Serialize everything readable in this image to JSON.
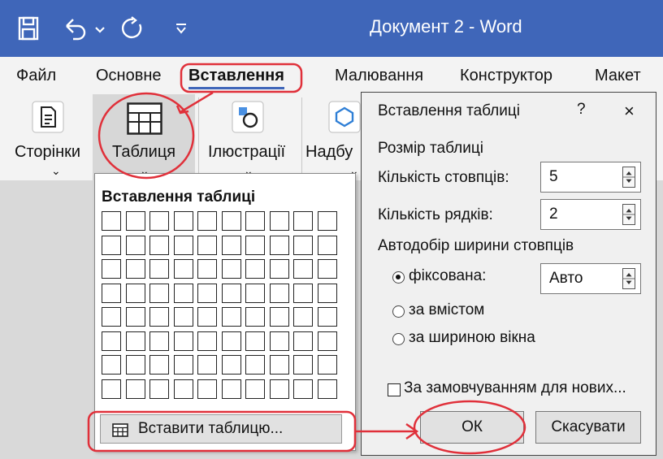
{
  "window": {
    "title": "Документ 2 - Word",
    "accent_color": "#3f66b9",
    "icons": [
      "save-icon",
      "undo-icon",
      "redo-icon",
      "customize-qat-icon"
    ]
  },
  "menu": {
    "items": [
      "Файл",
      "Основне",
      "Вставлення",
      "Малювання",
      "Конструктор",
      "Макет"
    ],
    "active": "Вставлення"
  },
  "ribbon": {
    "groups": [
      {
        "label": "Сторінки",
        "icon": "pages-icon"
      },
      {
        "label": "Таблиця",
        "icon": "table-icon"
      },
      {
        "label": "Ілюстрації",
        "icon": "illustrations-icon"
      },
      {
        "label": "Надбу",
        "icon": "addins-icon"
      }
    ]
  },
  "table_panel": {
    "title": "Вставлення таблиці",
    "grid_columns": 10,
    "grid_rows": 8,
    "insert_button": "Вставити таблицю..."
  },
  "dialog": {
    "title": "Вставлення таблиці",
    "help": "?",
    "close": "×",
    "size_section": "Розмір таблиці",
    "columns_label": "Кількість стовпців:",
    "columns_value": "5",
    "rows_label": "Кількість рядків:",
    "rows_value": "2",
    "autofit_section": "Автодобір ширини стовпців",
    "options": [
      {
        "label": "фіксована:",
        "selected": true
      },
      {
        "label": "за вмістом",
        "selected": false
      },
      {
        "label": "за шириною вікна",
        "selected": false
      }
    ],
    "fixed_value": "Авто",
    "default_checkbox": "За замовчуванням для нових...",
    "default_checked": false,
    "ok": "ОК",
    "cancel": "Скасувати"
  },
  "annotation_color": "#e0303a"
}
